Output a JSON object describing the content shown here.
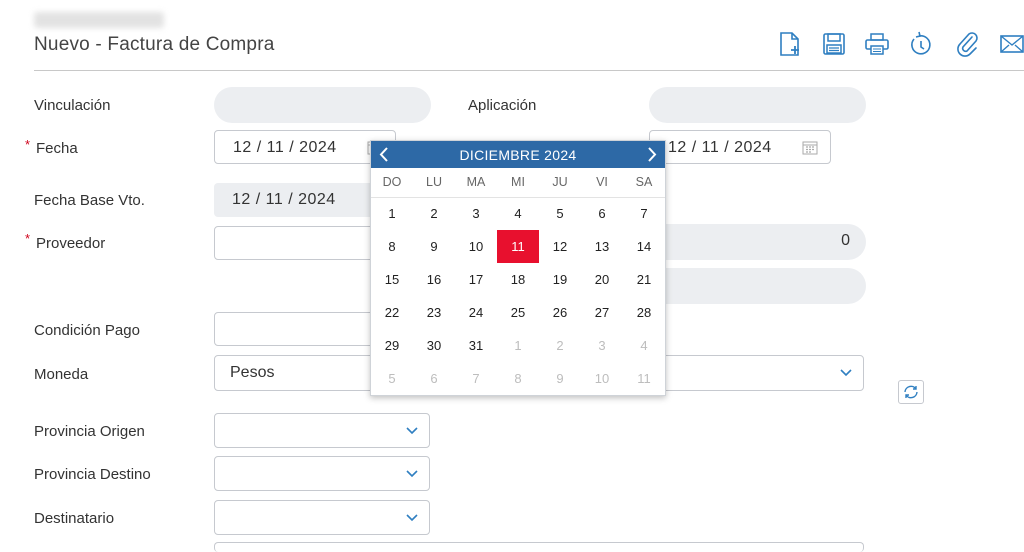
{
  "page": {
    "title": "Nuevo - Factura de Compra"
  },
  "toolbar": {
    "icons": [
      "new-document-icon",
      "save-icon",
      "print-icon",
      "history-icon",
      "attachment-icon",
      "email-icon"
    ]
  },
  "form": {
    "vinculacion_label": "Vinculación",
    "aplicacion_label": "Aplicación",
    "fecha_label": "Fecha",
    "fecha_value": "12 / 11 / 2024",
    "fecha2_value": "12 / 11 / 2024",
    "fecha_base_label": "Fecha Base Vto.",
    "fecha_base_value": "12 / 11 / 2024",
    "proveedor_label": "Proveedor",
    "proveedor_side_value": "0",
    "condicion_label": "Condición Pago",
    "moneda_label": "Moneda",
    "moneda_value": "Pesos",
    "provincia_origen_label": "Provincia Origen",
    "provincia_destino_label": "Provincia Destino",
    "destinatario_label": "Destinatario",
    "required_mark": "*"
  },
  "datepicker": {
    "month_label": "DICIEMBRE 2024",
    "weekdays": [
      "DO",
      "LU",
      "MA",
      "MI",
      "JU",
      "VI",
      "SA"
    ],
    "selected_day": "11",
    "weeks": [
      [
        {
          "d": "1"
        },
        {
          "d": "2"
        },
        {
          "d": "3"
        },
        {
          "d": "4"
        },
        {
          "d": "5"
        },
        {
          "d": "6"
        },
        {
          "d": "7"
        }
      ],
      [
        {
          "d": "8"
        },
        {
          "d": "9"
        },
        {
          "d": "10"
        },
        {
          "d": "11",
          "sel": true
        },
        {
          "d": "12"
        },
        {
          "d": "13"
        },
        {
          "d": "14"
        }
      ],
      [
        {
          "d": "15"
        },
        {
          "d": "16"
        },
        {
          "d": "17"
        },
        {
          "d": "18"
        },
        {
          "d": "19"
        },
        {
          "d": "20"
        },
        {
          "d": "21"
        }
      ],
      [
        {
          "d": "22"
        },
        {
          "d": "23"
        },
        {
          "d": "24"
        },
        {
          "d": "25"
        },
        {
          "d": "26"
        },
        {
          "d": "27"
        },
        {
          "d": "28"
        }
      ],
      [
        {
          "d": "29"
        },
        {
          "d": "30"
        },
        {
          "d": "31"
        },
        {
          "d": "1",
          "m": true
        },
        {
          "d": "2",
          "m": true
        },
        {
          "d": "3",
          "m": true
        },
        {
          "d": "4",
          "m": true
        }
      ],
      [
        {
          "d": "5",
          "m": true
        },
        {
          "d": "6",
          "m": true
        },
        {
          "d": "7",
          "m": true
        },
        {
          "d": "8",
          "m": true
        },
        {
          "d": "9",
          "m": true
        },
        {
          "d": "10",
          "m": true
        },
        {
          "d": "11",
          "m": true
        }
      ]
    ]
  },
  "colors": {
    "header_blue": "#2d69a6",
    "selected_red": "#e8102e",
    "icon_blue": "#2f7fc1",
    "required_red": "#d0021b"
  }
}
